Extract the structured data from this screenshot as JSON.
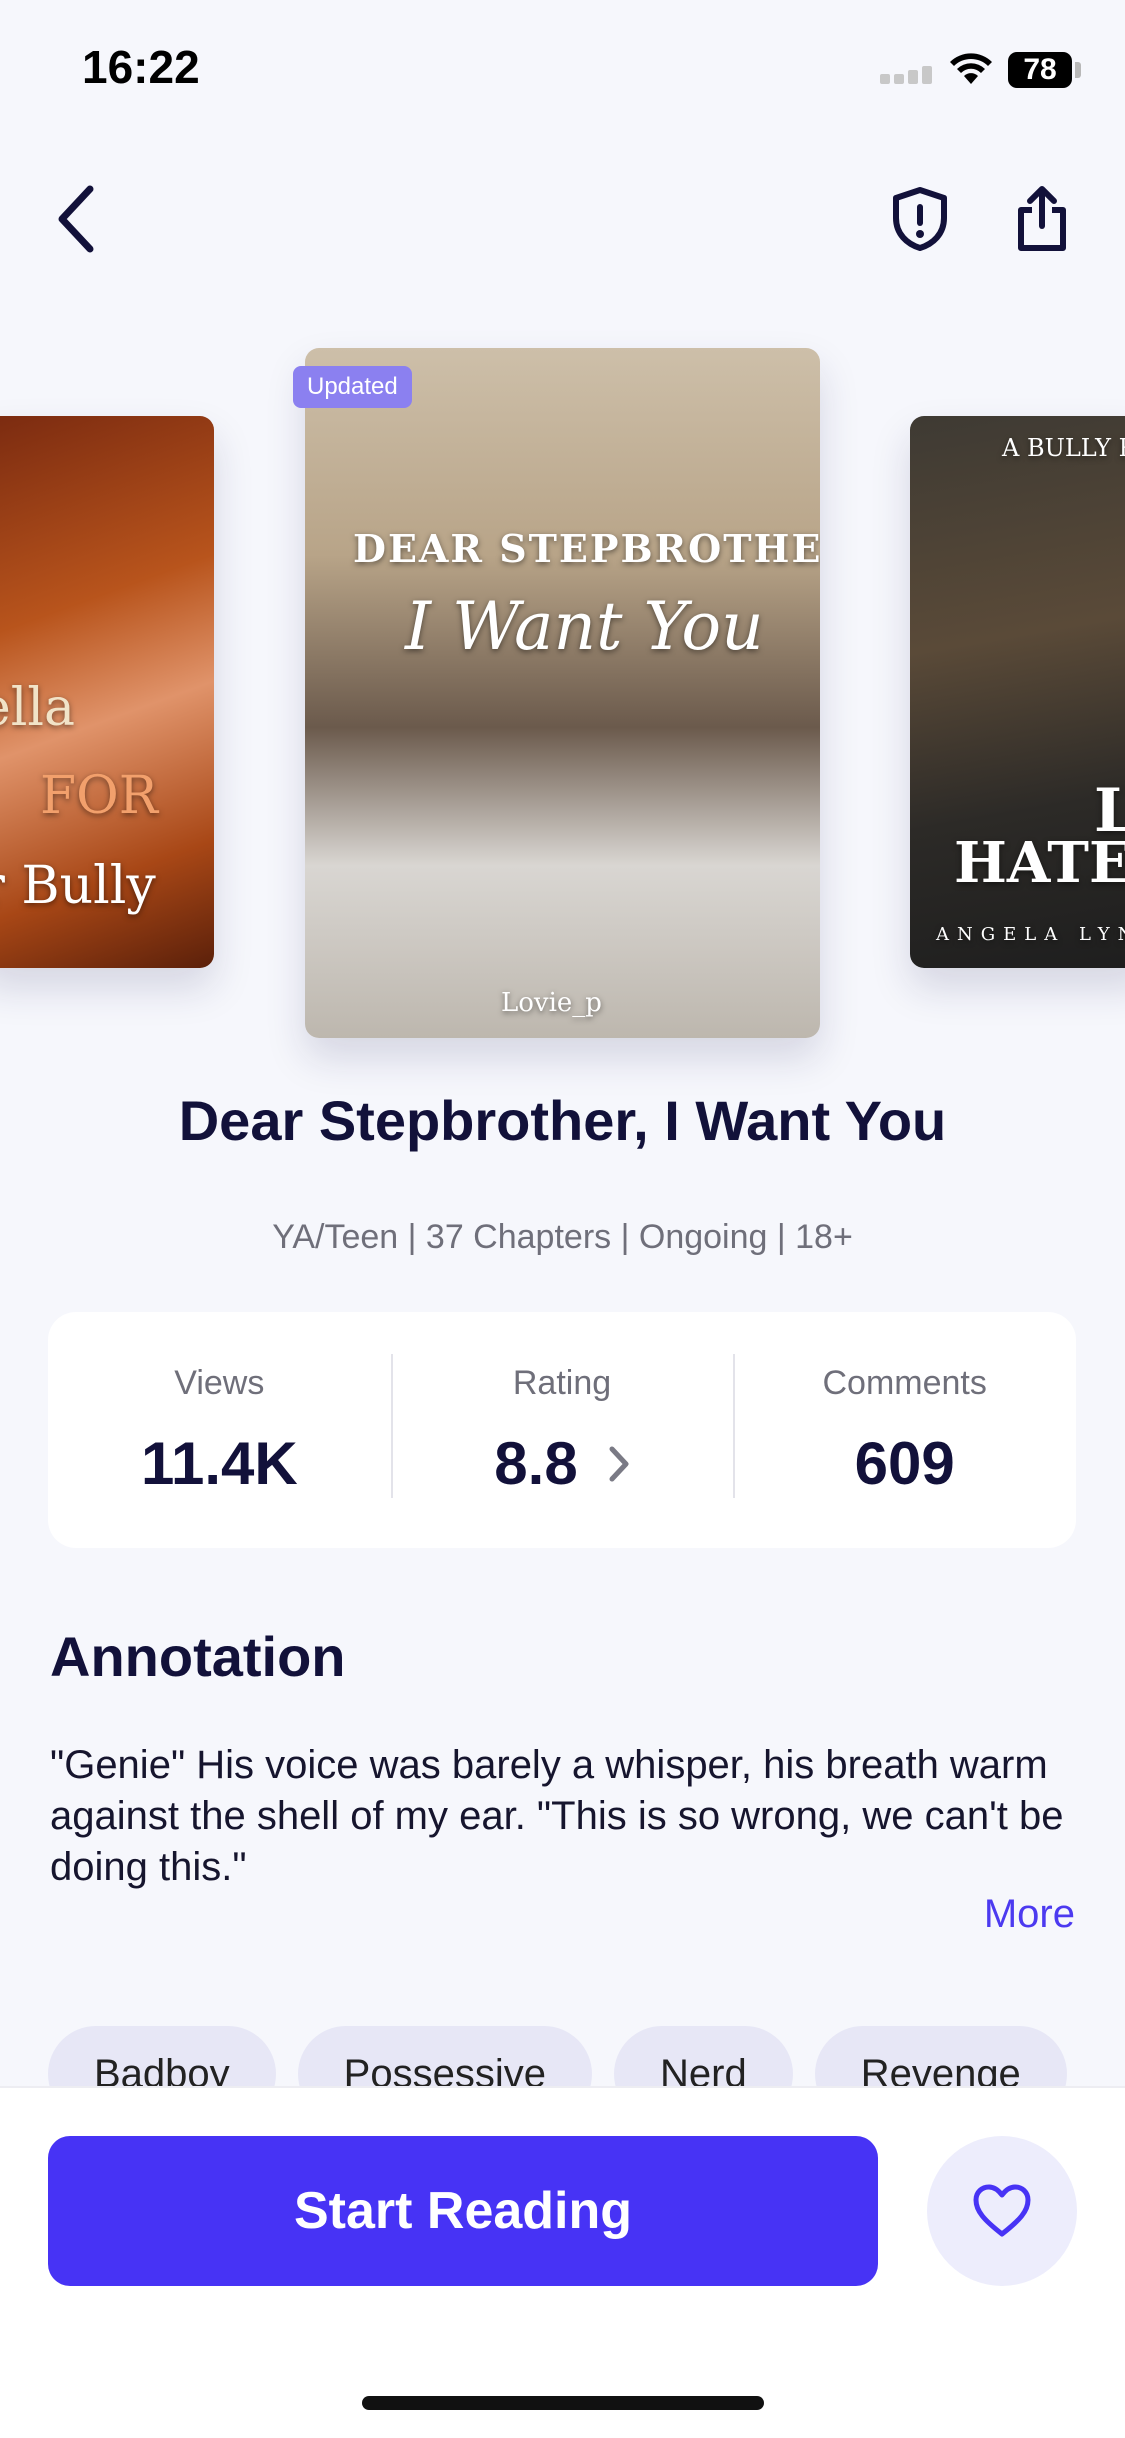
{
  "status_bar": {
    "time": "16:22",
    "battery": "78"
  },
  "nav": {
    "back_icon": "chevron-left-icon",
    "report_icon": "shield-alert-icon",
    "share_icon": "share-icon"
  },
  "carousel": {
    "left_cover": {
      "lines": [
        "ella",
        "FOR",
        "r Bully"
      ]
    },
    "center_cover": {
      "badge": "Updated",
      "line1": "DEAR STEPBROTHER,",
      "line2": "I Want You",
      "author": "Lovie_p"
    },
    "right_cover": {
      "line1": "A BULLY RO",
      "line2": "LI",
      "line3": "HATE",
      "author": "ANGELA LYN"
    }
  },
  "book": {
    "title": "Dear Stepbrother, I Want You",
    "meta": "YA/Teen | 37 Chapters | Ongoing | 18+"
  },
  "stats": {
    "views_label": "Views",
    "views_value": "11.4K",
    "rating_label": "Rating",
    "rating_value": "8.8",
    "comments_label": "Comments",
    "comments_value": "609"
  },
  "annotation": {
    "title": "Annotation",
    "text": "\"Genie\" His voice was barely a whisper, his breath warm against the shell of my ear. \"This is so wrong, we can't be doing this.\"",
    "more": "More"
  },
  "tags": [
    "Badboy",
    "Possessive",
    "Nerd",
    "Revenge"
  ],
  "actions": {
    "start_reading": "Start Reading",
    "favorite_icon": "heart-icon"
  },
  "colors": {
    "accent": "#4733F5",
    "badge": "#8B80F0",
    "background": "#F6F7FC"
  }
}
